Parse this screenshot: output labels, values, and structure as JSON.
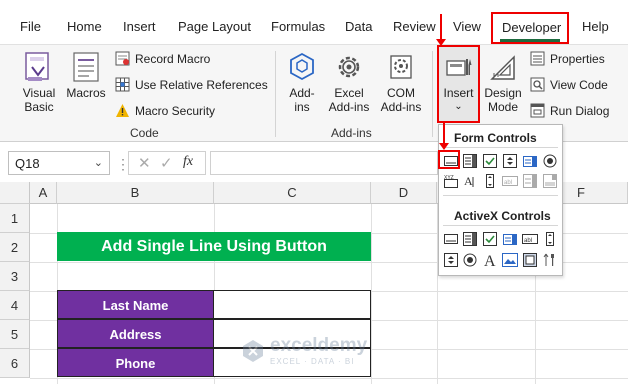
{
  "tabs": [
    "File",
    "Home",
    "Insert",
    "Page Layout",
    "Formulas",
    "Data",
    "Review",
    "View",
    "Developer",
    "Help"
  ],
  "ribbon": {
    "code": {
      "visual_basic": [
        "Visual",
        "Basic"
      ],
      "macros": "Macros",
      "record_macro": "Record Macro",
      "relative_refs": "Use Relative References",
      "macro_security": "Macro Security",
      "label": "Code"
    },
    "addins": {
      "addins": [
        "Add-",
        "ins"
      ],
      "excel_addins": [
        "Excel",
        "Add-ins"
      ],
      "com_addins": [
        "COM",
        "Add-ins"
      ],
      "label": "Add-ins"
    },
    "controls": {
      "insert": "Insert",
      "design_mode": [
        "Design",
        "Mode"
      ],
      "properties": "Properties",
      "view_code": "View Code",
      "run_dialog": "Run Dialog"
    }
  },
  "formula_bar": {
    "name_box": "Q18",
    "fx": "fx",
    "formula": ""
  },
  "grid": {
    "columns": [
      "A",
      "B",
      "C",
      "D",
      "E",
      "F"
    ],
    "rows": [
      "1",
      "2",
      "3",
      "4",
      "5",
      "6"
    ],
    "title": "Add Single Line Using Button",
    "labels": [
      "Last Name",
      "Address",
      "Phone"
    ]
  },
  "dropdown": {
    "form_controls": "Form Controls",
    "activex_controls": "ActiveX Controls"
  },
  "watermark": {
    "name": "exceldemy",
    "tagline": "EXCEL · DATA · BI"
  },
  "colors": {
    "accent_red": "#e00000",
    "title_green": "#00b050",
    "label_purple": "#7030a0",
    "developer_underline": "#1d6b3f"
  }
}
